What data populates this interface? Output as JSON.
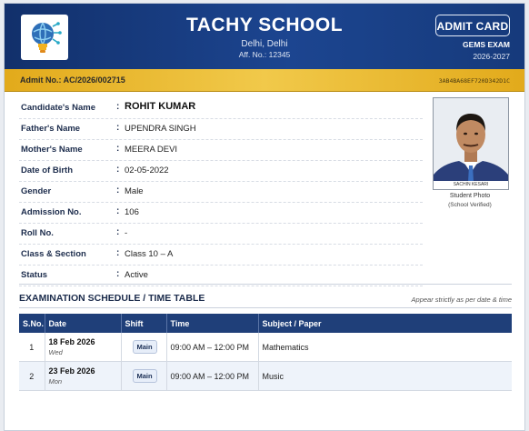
{
  "school": {
    "name": "TACHY SCHOOL",
    "city": "Delhi, Delhi",
    "affiliation": "Aff. No.: 12345"
  },
  "badge": {
    "label": "ADMIT CARD",
    "exam": "GEMS EXAM",
    "session": "2026-2027"
  },
  "admit": {
    "number": "Admit No.: AC/2026/002715",
    "hash": "3AB4BA68EF720D342D1C"
  },
  "candidate": [
    {
      "label": "Candidate's Name",
      "value": "ROHIT KUMAR"
    },
    {
      "label": "Father's Name",
      "value": "UPENDRA SINGH"
    },
    {
      "label": "Mother's Name",
      "value": "MEERA DEVI"
    },
    {
      "label": "Date of Birth",
      "value": "02-05-2022"
    },
    {
      "label": "Gender",
      "value": "Male"
    },
    {
      "label": "Admission No.",
      "value": "106"
    },
    {
      "label": "Roll No.",
      "value": "-"
    },
    {
      "label": "Class & Section",
      "value": "Class 10 – A"
    },
    {
      "label": "Status",
      "value": "Active"
    }
  ],
  "colon": ":",
  "photo": {
    "tag": "SACHIN KESARI",
    "caption": "Student Photo",
    "verified": "(School Verified)"
  },
  "schedule": {
    "title": "EXAMINATION SCHEDULE / TIME TABLE",
    "note": "Appear strictly as per date & time",
    "headers": [
      "S.No.",
      "Date",
      "Shift",
      "Time",
      "Subject / Paper"
    ],
    "rows": [
      {
        "sno": "1",
        "date": "18 Feb 2026",
        "day": "Wed",
        "shift": "Main",
        "time": "09:00 AM – 12:00 PM",
        "subject": "Mathematics"
      },
      {
        "sno": "2",
        "date": "23 Feb 2026",
        "day": "Mon",
        "shift": "Main",
        "time": "09:00 AM – 12:00 PM",
        "subject": "Music"
      }
    ]
  },
  "colors": {
    "header": "#1c4590",
    "gold": "#f1c94a",
    "table_header": "#1f3f79"
  },
  "icons": {
    "logo": "lightbulb-globe-icon"
  }
}
